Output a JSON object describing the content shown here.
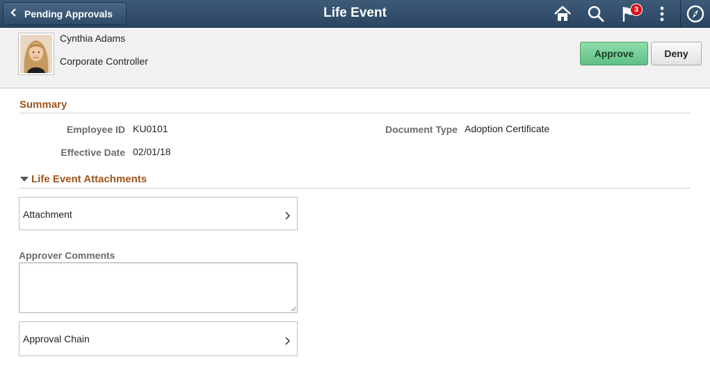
{
  "header": {
    "back_label": "Pending Approvals",
    "title": "Life Event",
    "notification_count": "3",
    "icons": [
      "chevron-left-icon",
      "home-icon",
      "search-icon",
      "flag-icon",
      "more-vertical-icon",
      "navbar-compass-icon"
    ]
  },
  "person": {
    "name": "Cynthia Adams",
    "title": "Corporate Controller"
  },
  "actions": {
    "approve_label": "Approve",
    "deny_label": "Deny",
    "approve_color": "#6ccb92"
  },
  "summary": {
    "title": "Summary",
    "fields": [
      {
        "label": "Employee ID",
        "value": "KU0101"
      },
      {
        "label": "Effective Date",
        "value": "02/01/18"
      },
      {
        "label": "Document Type",
        "value": "Adoption Certificate"
      }
    ]
  },
  "attachments": {
    "title": "Life Event Attachments",
    "row_label": "Attachment"
  },
  "comments": {
    "label": "Approver Comments",
    "value": ""
  },
  "approval_chain": {
    "label": "Approval Chain"
  },
  "colors": {
    "header_bg": "#2f4b69",
    "section_title": "#a0541b"
  }
}
